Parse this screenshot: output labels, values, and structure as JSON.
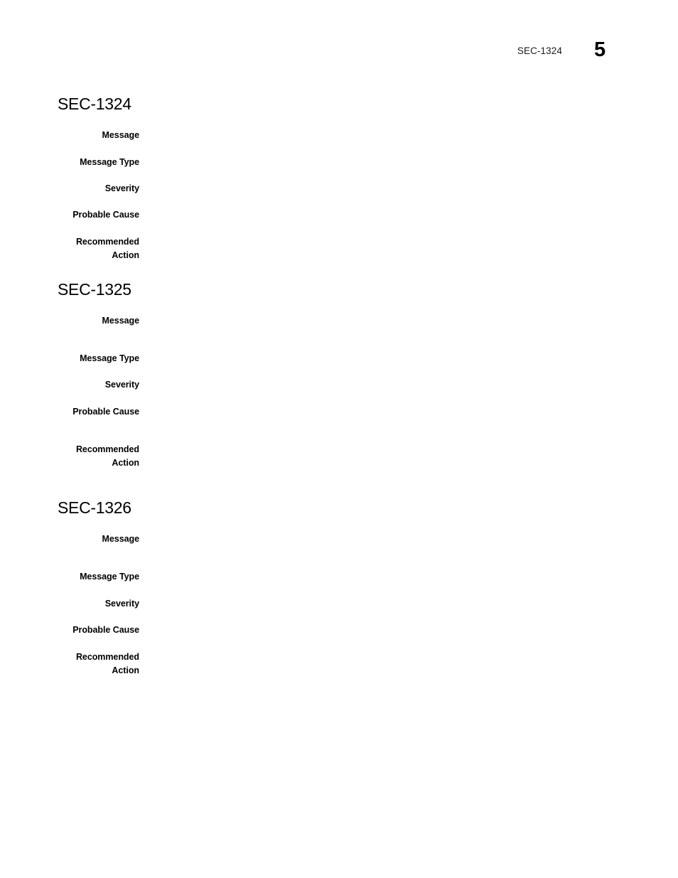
{
  "header": {
    "section_ref": "SEC-1324",
    "page_number": "5"
  },
  "labels": {
    "message": "Message",
    "message_type": "Message Type",
    "severity": "Severity",
    "probable_cause": "Probable Cause",
    "recommended_action_line1": "Recommended",
    "recommended_action_line2": "Action"
  },
  "sections": [
    {
      "heading": "SEC-1324",
      "fields": {
        "message": "",
        "message_type": "",
        "severity": "",
        "probable_cause": "",
        "recommended_action": ""
      }
    },
    {
      "heading": "SEC-1325",
      "fields": {
        "message": "",
        "message_type": "",
        "severity": "",
        "probable_cause": "",
        "recommended_action": ""
      }
    },
    {
      "heading": "SEC-1326",
      "fields": {
        "message": "",
        "message_type": "",
        "severity": "",
        "probable_cause": "",
        "recommended_action": ""
      }
    }
  ]
}
